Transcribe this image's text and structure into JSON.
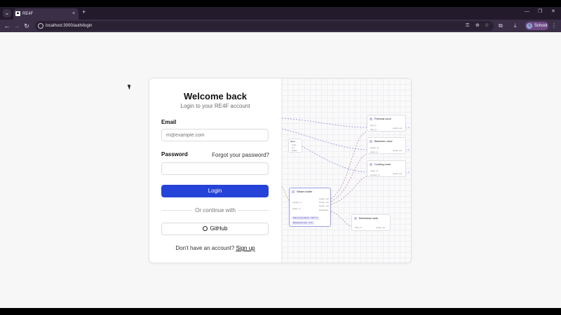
{
  "browser": {
    "tab_title": "RE4F",
    "tab_close": "×",
    "new_tab": "+",
    "url": "localhost:3000/auth/login",
    "profile_initial": "S",
    "profile_name": "School",
    "icons": [
      "tab-list-icon",
      "back-icon",
      "forward-icon",
      "reload-icon",
      "site-info-icon",
      "password-key-icon",
      "zoom-icon",
      "bookmark-star-icon",
      "extensions-icon",
      "download-icon",
      "menu-icon",
      "minimize-icon",
      "maximize-icon",
      "close-window-icon"
    ]
  },
  "login": {
    "title": "Welcome back",
    "subtitle": "Login to your RE4F account",
    "email_label": "Email",
    "email_placeholder": "m@example.com",
    "password_label": "Password",
    "forgot_password": "Forgot your password?",
    "login_button": "Login",
    "divider_text": "Or continue with",
    "github_button": "GitHub",
    "no_account_text": "Don't have an account?",
    "signup_link": "Sign up",
    "accent_color": "#2543d8"
  },
  "diagram": {
    "nodes": [
      {
        "title": "Preheat zone",
        "rows": [
          "gas_in",
          "flow_in"
        ],
        "output": "outlet_out"
      },
      {
        "title": "Blancher zone",
        "rows": [
          "steam_in",
          "water_in"
        ],
        "output": "outlet_out"
      },
      {
        "title": "Cooling zone",
        "rows": [
          "water_in",
          "product_in"
        ],
        "output": "outlet_out"
      },
      {
        "title": "Steam boiler",
        "rows": [
          "supply_in",
          "water_in",
          "steam_out",
          "steam_out",
          "steam_out",
          "blowdown"
        ],
        "pills": [
          "Max temperature · 120 °C",
          "Blowdown rate · 4 %"
        ]
      },
      {
        "title": "Blowdown tank",
        "rows": [
          "inlet_in"
        ],
        "output": "outlet_out"
      },
      {
        "title": "Mixer",
        "rows": [
          "Fuel",
          "Air",
          "Water"
        ]
      }
    ],
    "edge_label": "flow"
  }
}
